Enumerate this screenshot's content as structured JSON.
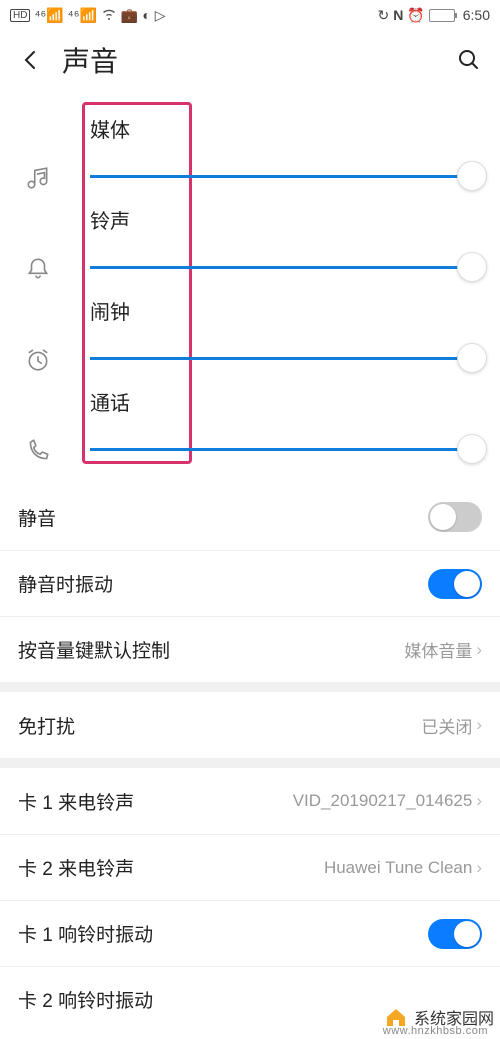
{
  "status": {
    "hd": "HD",
    "time": "6:50"
  },
  "nav": {
    "title": "声音"
  },
  "sliders": [
    {
      "label": "媒体",
      "icon": "music"
    },
    {
      "label": "铃声",
      "icon": "bell"
    },
    {
      "label": "闹钟",
      "icon": "alarm"
    },
    {
      "label": "通话",
      "icon": "phone"
    }
  ],
  "rows": {
    "mute": {
      "label": "静音",
      "on": false
    },
    "vibrate_mute": {
      "label": "静音时振动",
      "on": true
    },
    "vol_default": {
      "label": "按音量键默认控制",
      "value": "媒体音量"
    },
    "dnd": {
      "label": "免打扰",
      "value": "已关闭"
    },
    "sim1_ring": {
      "label": "卡 1 来电铃声",
      "value": "VID_20190217_014625"
    },
    "sim2_ring": {
      "label": "卡 2 来电铃声",
      "value": "Huawei Tune Clean"
    },
    "sim1_vib": {
      "label": "卡 1 响铃时振动",
      "on": true
    },
    "sim2_vib": {
      "label": "卡 2 响铃时振动"
    }
  },
  "watermark": {
    "text": "系统家园网",
    "url": "www.hnzkhbsb.com"
  }
}
